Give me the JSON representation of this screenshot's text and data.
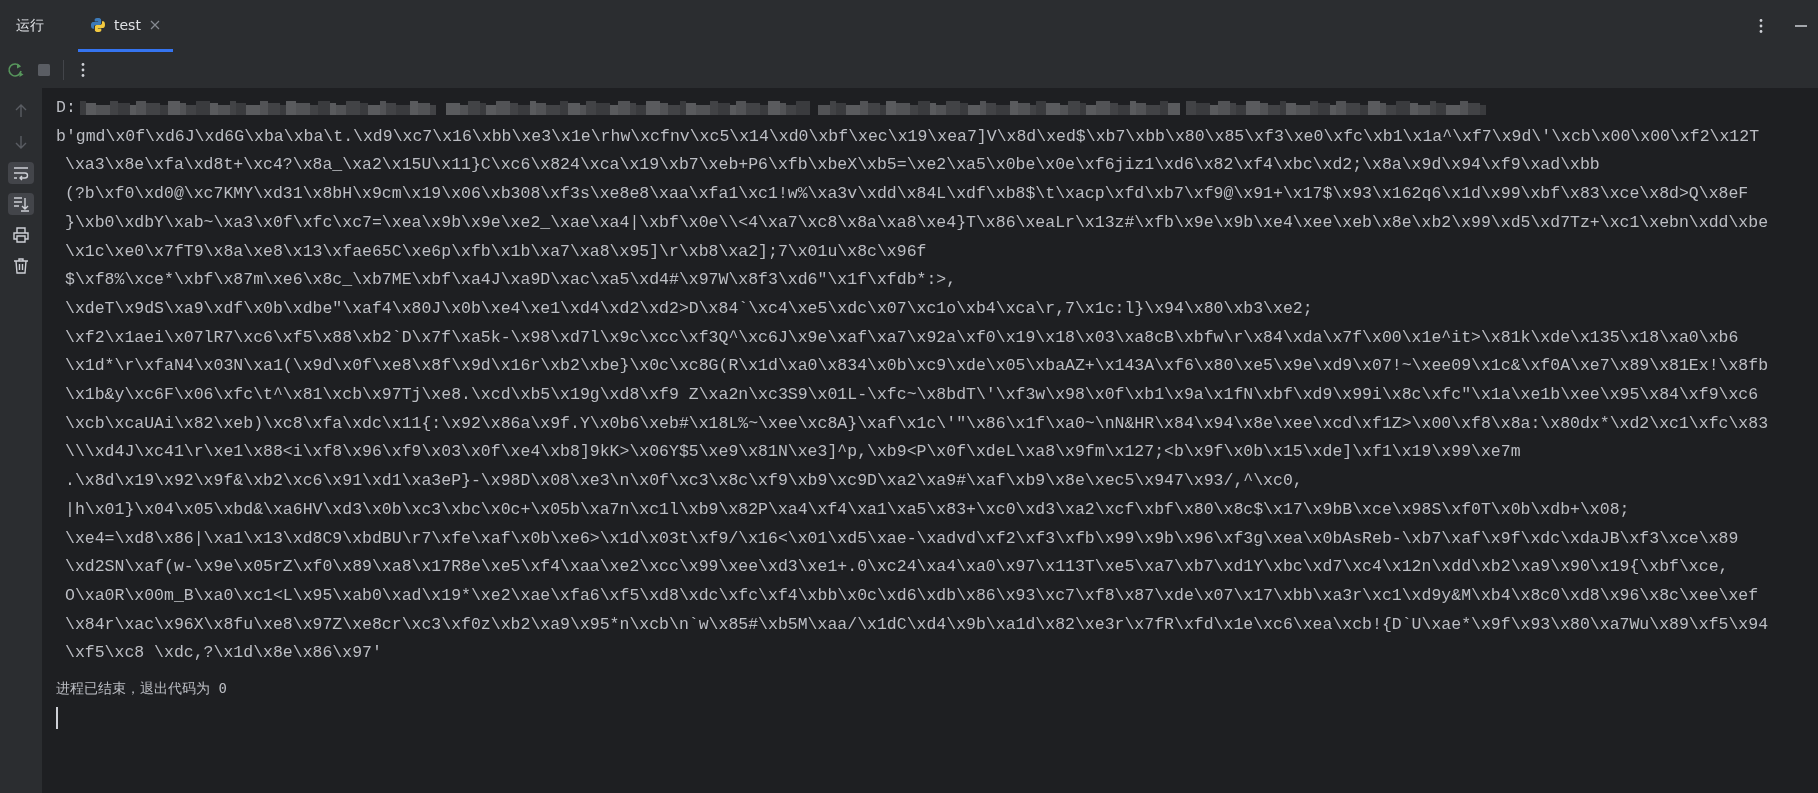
{
  "tool_window": {
    "title": "运行"
  },
  "tabs": [
    {
      "label": "test",
      "selected": true
    }
  ],
  "toolbar": [
    {
      "kind": "rerun",
      "disabled": false
    },
    {
      "kind": "stop",
      "disabled": true
    },
    {
      "kind": "more",
      "disabled": false
    }
  ],
  "gutter": [
    {
      "kind": "up",
      "on": false,
      "disabled": true
    },
    {
      "kind": "down",
      "on": false,
      "disabled": true
    },
    {
      "kind": "wrap",
      "on": true,
      "disabled": false
    },
    {
      "kind": "scroll-end",
      "on": true,
      "disabled": false
    },
    {
      "kind": "print",
      "on": false,
      "disabled": false
    },
    {
      "kind": "clear",
      "on": false,
      "disabled": false
    }
  ],
  "console": {
    "path_prefix": "D:",
    "bytes_lines": [
      "b'gmd\\x0f\\xd6J\\xd6G\\xba\\xba\\t.\\xd9\\xc7\\x16\\xbb\\xe3\\x1e\\rhw\\xcfnv\\xc5\\x14\\xd0\\xbf\\xec\\x19\\xea7]V\\x8d\\xed$\\xb7\\xbb\\x80\\x85\\xf3\\xe0\\xfc\\xb1\\x1a^\\xf7\\x9d\\'\\xcb\\x00\\x00\\xf2\\x12T",
      "\\xa3\\x8e\\xfa\\xd8t+\\xc4?\\x8a_\\xa2\\x15U\\x11}C\\xc6\\x824\\xca\\x19\\xb7\\xeb+P6\\xfb\\xbeX\\xb5=\\xe2\\xa5\\x0be\\x0e\\xf6jiz1\\xd6\\x82\\xf4\\xbc\\xd2;\\x8a\\x9d\\x94\\xf9\\xad\\xbb",
      "(?b\\xf0\\xd0@\\xc7KMY\\xd31\\x8bH\\x9cm\\x19\\x06\\xb308\\xf3s\\xe8e8\\xaa\\xfa1\\xc1!w%\\xa3v\\xdd\\x84L\\xdf\\xb8$\\t\\xacp\\xfd\\xb7\\xf9@\\x91+\\x17$\\x93\\x162q6\\x1d\\x99\\xbf\\x83\\xce\\x8d>Q\\x8eF",
      "}\\xb0\\xdbY\\xab~\\xa3\\x0f\\xfc\\xc7=\\xea\\x9b\\x9e\\xe2_\\xae\\xa4|\\xbf\\x0e\\\\<4\\xa7\\xc8\\x8a\\xa8\\xe4}T\\x86\\xeaLr\\x13z#\\xfb\\x9e\\x9b\\xe4\\xee\\xeb\\x8e\\xb2\\x99\\xd5\\xd7Tz+\\xc1\\xebn\\xdd\\xbe",
      "\\x1c\\xe0\\x7fT9\\x8a\\xe8\\x13\\xfae65C\\xe6p\\xfb\\x1b\\xa7\\xa8\\x95]\\r\\xb8\\xa2];7\\x01u\\x8c\\x96f",
      "$\\xf8%\\xce*\\xbf\\x87m\\xe6\\x8c_\\xb7ME\\xbf\\xa4J\\xa9D\\xac\\xa5\\xd4#\\x97W\\x8f3\\xd6\"\\x1f\\xfdb*:>,",
      "\\xdeT\\x9dS\\xa9\\xdf\\x0b\\xdbe\"\\xaf4\\x80J\\x0b\\xe4\\xe1\\xd4\\xd2\\xd2>D\\x84`\\xc4\\xe5\\xdc\\x07\\xc1o\\xb4\\xca\\r,7\\x1c:l}\\x94\\x80\\xb3\\xe2;",
      "\\xf2\\x1aei\\x07lR7\\xc6\\xf5\\x88\\xb2`D\\x7f\\xa5k-\\x98\\xd7l\\x9c\\xcc\\xf3Q^\\xc6J\\x9e\\xaf\\xa7\\x92a\\xf0\\x19\\x18\\x03\\xa8cB\\xbfw\\r\\x84\\xda\\x7f\\x00\\x1e^it>\\x81k\\xde\\x135\\x18\\xa0\\xb6",
      "\\x1d*\\r\\xfaN4\\x03N\\xa1(\\x9d\\x0f\\xe8\\x8f\\x9d\\x16r\\xb2\\xbe}\\x0c\\xc8G(R\\x1d\\xa0\\x834\\x0b\\xc9\\xde\\x05\\xbaAZ+\\x143A\\xf6\\x80\\xe5\\x9e\\xd9\\x07!~\\xee09\\x1c&\\xf0A\\xe7\\x89\\x81Ex!\\x8fb",
      "\\x1b&y\\xc6F\\x06\\xfc\\t^\\x81\\xcb\\x97Tj\\xe8.\\xcd\\xb5\\x19g\\xd8\\xf9 Z\\xa2n\\xc3S9\\x01L-\\xfc~\\x8bdT\\'\\xf3w\\x98\\x0f\\xb1\\x9a\\x1fN\\xbf\\xd9\\x99i\\x8c\\xfc\"\\x1a\\xe1b\\xee\\x95\\x84\\xf9\\xc6",
      "\\xcb\\xcaUAi\\x82\\xeb)\\xc8\\xfa\\xdc\\x11{:\\x92\\x86a\\x9f.Y\\x0b6\\xeb#\\x18L%~\\xee\\xc8A}\\xaf\\x1c\\'\"\\x86\\x1f\\xa0~\\nN&HR\\x84\\x94\\x8e\\xee\\xcd\\xf1Z>\\x00\\xf8\\x8a:\\x80dx*\\xd2\\xc1\\xfc\\x83",
      "\\\\\\xd4J\\xc41\\r\\xe1\\x88<i\\xf8\\x96\\xf9\\x03\\x0f\\xe4\\xb8]9kK>\\x06Y$5\\xe9\\x81N\\xe3]^p,\\xb9<P\\x0f\\xdeL\\xa8\\x9fm\\x127;<b\\x9f\\x0b\\x15\\xde]\\xf1\\x19\\x99\\xe7m",
      ".\\x8d\\x19\\x92\\x9f&\\xb2\\xc6\\x91\\xd1\\xa3eP}-\\x98D\\x08\\xe3\\n\\x0f\\xc3\\x8c\\xf9\\xb9\\xc9D\\xa2\\xa9#\\xaf\\xb9\\x8e\\xec5\\x947\\x93/,^\\xc0,",
      "|h\\x01}\\x04\\x05\\xbd&\\xa6HV\\xd3\\x0b\\xc3\\xbc\\x0c+\\x05b\\xa7n\\xc1l\\xb9\\x82P\\xa4\\xf4\\xa1\\xa5\\x83+\\xc0\\xd3\\xa2\\xcf\\xbf\\x80\\x8c$\\x17\\x9bB\\xce\\x98S\\xf0T\\x0b\\xdb+\\x08;",
      "\\xe4=\\xd8\\x86|\\xa1\\x13\\xd8C9\\xbdBU\\r7\\xfe\\xaf\\x0b\\xe6>\\x1d\\x03t\\xf9/\\x16<\\x01\\xd5\\xae-\\xadvd\\xf2\\xf3\\xfb\\x99\\x9b\\x96\\xf3g\\xea\\x0bAsReb-\\xb7\\xaf\\x9f\\xdc\\xdaJB\\xf3\\xce\\x89",
      "\\xd2SN\\xaf(w-\\x9e\\x05rZ\\xf0\\x89\\xa8\\x17R8e\\xe5\\xf4\\xaa\\xe2\\xcc\\x99\\xee\\xd3\\xe1+.0\\xc24\\xa4\\xa0\\x97\\x113T\\xe5\\xa7\\xb7\\xd1Y\\xbc\\xd7\\xc4\\x12n\\xdd\\xb2\\xa9\\x90\\x19{\\xbf\\xce,",
      "O\\xa0R\\x00m_B\\xa0\\xc1<L\\x95\\xab0\\xad\\x19*\\xe2\\xae\\xfa6\\xf5\\xd8\\xdc\\xfc\\xf4\\xbb\\x0c\\xd6\\xdb\\x86\\x93\\xc7\\xf8\\x87\\xde\\x07\\x17\\xbb\\xa3r\\xc1\\xd9y&M\\xb4\\x8c0\\xd8\\x96\\x8c\\xee\\xef",
      "\\x84r\\xac\\x96X\\x8fu\\xe8\\x97Z\\xe8cr\\xc3\\xf0z\\xb2\\xa9\\x95*n\\xcb\\n`w\\x85#\\xb5M\\xaa/\\x1dC\\xd4\\x9b\\xa1d\\x82\\xe3r\\x7fR\\xfd\\x1e\\xc6\\xea\\xcb!{D`U\\xae*\\x9f\\x93\\x80\\xa7Wu\\x89\\xf5\\x94",
      "\\xf5\\xc8 \\xdc,?\\x1d\\x8e\\x86\\x97'"
    ],
    "exit_message": "进程已结束，退出代码为 0"
  }
}
